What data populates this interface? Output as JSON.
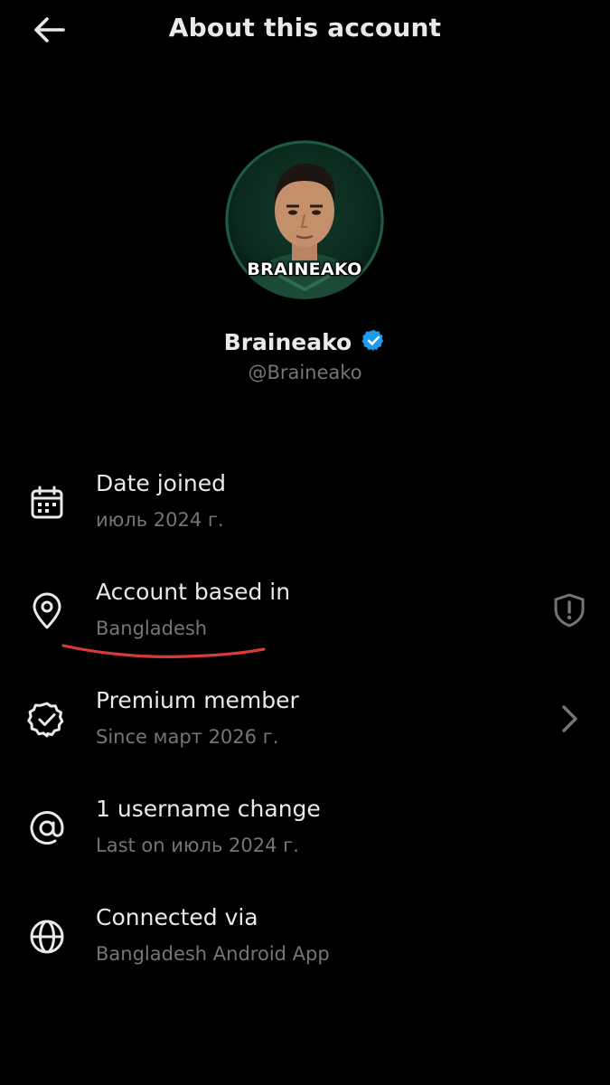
{
  "header": {
    "title": "About this account",
    "back_icon": "arrow-left-icon"
  },
  "profile": {
    "avatar_caption": "BRAINEAKO",
    "display_name": "Braineako",
    "handle": "@Braineako",
    "verified_icon": "verified-badge-icon"
  },
  "rows": [
    {
      "icon": "calendar-icon",
      "title": "Date joined",
      "subtitle": "июль 2024 г."
    },
    {
      "icon": "location-pin-icon",
      "title": "Account based in",
      "subtitle": "Bangladesh",
      "right_icon": "shield-alert-icon"
    },
    {
      "icon": "badge-check-icon",
      "title": "Premium member",
      "subtitle": "Since март 2026 г.",
      "right_icon": "chevron-right-icon"
    },
    {
      "icon": "at-sign-icon",
      "title": "1 username change",
      "subtitle": "Last on июль 2024 г."
    },
    {
      "icon": "globe-icon",
      "title": "Connected via",
      "subtitle": "Bangladesh Android App"
    }
  ],
  "colors": {
    "background": "#000000",
    "text_primary": "#e7e9ea",
    "text_secondary": "#71767b",
    "verified_blue": "#1d9bf0",
    "annotation_red": "#d93a3a"
  }
}
